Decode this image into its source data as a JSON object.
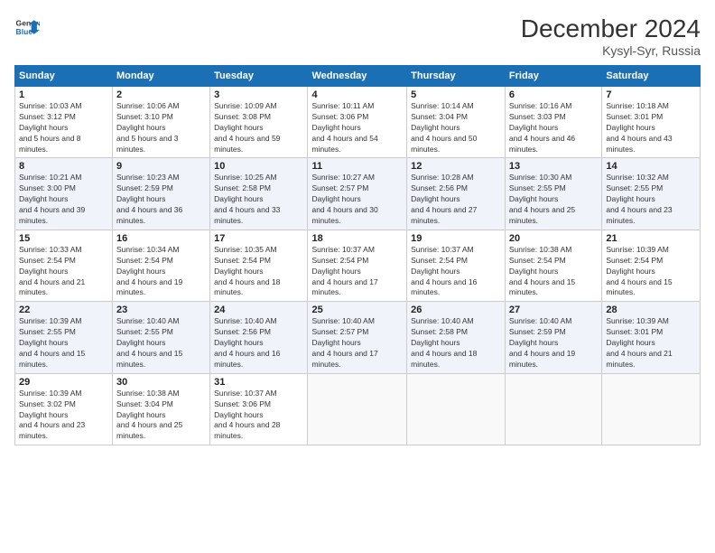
{
  "logo": {
    "line1": "General",
    "line2": "Blue"
  },
  "header": {
    "month": "December 2024",
    "location": "Kysyl-Syr, Russia"
  },
  "weekdays": [
    "Sunday",
    "Monday",
    "Tuesday",
    "Wednesday",
    "Thursday",
    "Friday",
    "Saturday"
  ],
  "weeks": [
    [
      {
        "day": "1",
        "sunrise": "10:03 AM",
        "sunset": "3:12 PM",
        "daylight": "5 hours and 8 minutes."
      },
      {
        "day": "2",
        "sunrise": "10:06 AM",
        "sunset": "3:10 PM",
        "daylight": "5 hours and 3 minutes."
      },
      {
        "day": "3",
        "sunrise": "10:09 AM",
        "sunset": "3:08 PM",
        "daylight": "4 hours and 59 minutes."
      },
      {
        "day": "4",
        "sunrise": "10:11 AM",
        "sunset": "3:06 PM",
        "daylight": "4 hours and 54 minutes."
      },
      {
        "day": "5",
        "sunrise": "10:14 AM",
        "sunset": "3:04 PM",
        "daylight": "4 hours and 50 minutes."
      },
      {
        "day": "6",
        "sunrise": "10:16 AM",
        "sunset": "3:03 PM",
        "daylight": "4 hours and 46 minutes."
      },
      {
        "day": "7",
        "sunrise": "10:18 AM",
        "sunset": "3:01 PM",
        "daylight": "4 hours and 43 minutes."
      }
    ],
    [
      {
        "day": "8",
        "sunrise": "10:21 AM",
        "sunset": "3:00 PM",
        "daylight": "4 hours and 39 minutes."
      },
      {
        "day": "9",
        "sunrise": "10:23 AM",
        "sunset": "2:59 PM",
        "daylight": "4 hours and 36 minutes."
      },
      {
        "day": "10",
        "sunrise": "10:25 AM",
        "sunset": "2:58 PM",
        "daylight": "4 hours and 33 minutes."
      },
      {
        "day": "11",
        "sunrise": "10:27 AM",
        "sunset": "2:57 PM",
        "daylight": "4 hours and 30 minutes."
      },
      {
        "day": "12",
        "sunrise": "10:28 AM",
        "sunset": "2:56 PM",
        "daylight": "4 hours and 27 minutes."
      },
      {
        "day": "13",
        "sunrise": "10:30 AM",
        "sunset": "2:55 PM",
        "daylight": "4 hours and 25 minutes."
      },
      {
        "day": "14",
        "sunrise": "10:32 AM",
        "sunset": "2:55 PM",
        "daylight": "4 hours and 23 minutes."
      }
    ],
    [
      {
        "day": "15",
        "sunrise": "10:33 AM",
        "sunset": "2:54 PM",
        "daylight": "4 hours and 21 minutes."
      },
      {
        "day": "16",
        "sunrise": "10:34 AM",
        "sunset": "2:54 PM",
        "daylight": "4 hours and 19 minutes."
      },
      {
        "day": "17",
        "sunrise": "10:35 AM",
        "sunset": "2:54 PM",
        "daylight": "4 hours and 18 minutes."
      },
      {
        "day": "18",
        "sunrise": "10:37 AM",
        "sunset": "2:54 PM",
        "daylight": "4 hours and 17 minutes."
      },
      {
        "day": "19",
        "sunrise": "10:37 AM",
        "sunset": "2:54 PM",
        "daylight": "4 hours and 16 minutes."
      },
      {
        "day": "20",
        "sunrise": "10:38 AM",
        "sunset": "2:54 PM",
        "daylight": "4 hours and 15 minutes."
      },
      {
        "day": "21",
        "sunrise": "10:39 AM",
        "sunset": "2:54 PM",
        "daylight": "4 hours and 15 minutes."
      }
    ],
    [
      {
        "day": "22",
        "sunrise": "10:39 AM",
        "sunset": "2:55 PM",
        "daylight": "4 hours and 15 minutes."
      },
      {
        "day": "23",
        "sunrise": "10:40 AM",
        "sunset": "2:55 PM",
        "daylight": "4 hours and 15 minutes."
      },
      {
        "day": "24",
        "sunrise": "10:40 AM",
        "sunset": "2:56 PM",
        "daylight": "4 hours and 16 minutes."
      },
      {
        "day": "25",
        "sunrise": "10:40 AM",
        "sunset": "2:57 PM",
        "daylight": "4 hours and 17 minutes."
      },
      {
        "day": "26",
        "sunrise": "10:40 AM",
        "sunset": "2:58 PM",
        "daylight": "4 hours and 18 minutes."
      },
      {
        "day": "27",
        "sunrise": "10:40 AM",
        "sunset": "2:59 PM",
        "daylight": "4 hours and 19 minutes."
      },
      {
        "day": "28",
        "sunrise": "10:39 AM",
        "sunset": "3:01 PM",
        "daylight": "4 hours and 21 minutes."
      }
    ],
    [
      {
        "day": "29",
        "sunrise": "10:39 AM",
        "sunset": "3:02 PM",
        "daylight": "4 hours and 23 minutes."
      },
      {
        "day": "30",
        "sunrise": "10:38 AM",
        "sunset": "3:04 PM",
        "daylight": "4 hours and 25 minutes."
      },
      {
        "day": "31",
        "sunrise": "10:37 AM",
        "sunset": "3:06 PM",
        "daylight": "4 hours and 28 minutes."
      },
      null,
      null,
      null,
      null
    ]
  ]
}
